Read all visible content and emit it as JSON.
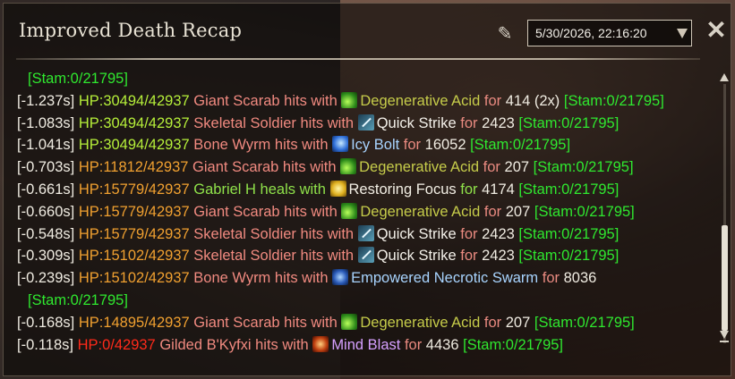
{
  "window": {
    "title": "Improved Death Recap",
    "date_value": "5/30/2026, 22:16:20"
  },
  "icons": {
    "quill": "quill-icon",
    "close": "close-icon",
    "dropdown": "chevron-down-icon"
  },
  "colors": {
    "hp_healthy": "#b6f03a",
    "hp_mid": "#f0a030",
    "hp_dead": "#ff2a1a",
    "stamina": "#2fe82f",
    "source": "#f18a80",
    "heal": "#8fe14a"
  },
  "log": {
    "wrap_top": "[Stam:0/21795]",
    "entries": [
      {
        "time": "[-1.237s]",
        "hp": "HP:30494/42937",
        "source": "Giant Scarab hits with",
        "icon": "acid-icon",
        "ability": "Degenerative Acid",
        "for": "for",
        "amount": "414",
        "extra": "(2x)",
        "stam": "[Stam:0/21795]"
      },
      {
        "time": "[-1.083s]",
        "hp": "HP:30494/42937",
        "source": "Skeletal Soldier hits with",
        "icon": "sword-icon",
        "ability": "Quick Strike",
        "for": "for",
        "amount": "2423",
        "stam": "[Stam:0/21795]"
      },
      {
        "time": "[-1.041s]",
        "hp": "HP:30494/42937",
        "source": "Bone Wyrm hits with",
        "icon": "frost-bolt-icon",
        "ability": "Icy Bolt",
        "for": "for",
        "amount": "16052",
        "stam": "[Stam:0/21795]"
      },
      {
        "time": "[-0.703s]",
        "hp": "HP:11812/42937",
        "source": "Giant Scarab hits with",
        "icon": "acid-icon",
        "ability": "Degenerative Acid",
        "for": "for",
        "amount": "207",
        "stam": "[Stam:0/21795]"
      },
      {
        "time": "[-0.661s]",
        "hp": "HP:15779/42937",
        "source": "Gabriel H heals with",
        "icon": "heal-icon",
        "ability": "Restoring Focus",
        "for": "for",
        "amount": "4174",
        "stam": "[Stam:0/21795]"
      },
      {
        "time": "[-0.660s]",
        "hp": "HP:15779/42937",
        "source": "Giant Scarab hits with",
        "icon": "acid-icon",
        "ability": "Degenerative Acid",
        "for": "for",
        "amount": "207",
        "stam": "[Stam:0/21795]"
      },
      {
        "time": "[-0.548s]",
        "hp": "HP:15779/42937",
        "source": "Skeletal Soldier hits with",
        "icon": "sword-icon",
        "ability": "Quick Strike",
        "for": "for",
        "amount": "2423",
        "stam": "[Stam:0/21795]"
      },
      {
        "time": "[-0.309s]",
        "hp": "HP:15102/42937",
        "source": "Skeletal Soldier hits with",
        "icon": "sword-icon",
        "ability": "Quick Strike",
        "for": "for",
        "amount": "2423",
        "stam": "[Stam:0/21795]"
      },
      {
        "time": "[-0.239s]",
        "hp": "HP:15102/42937",
        "source": "Bone Wyrm hits with",
        "icon": "swarm-icon",
        "ability": "Empowered Necrotic Swarm",
        "for": "for",
        "amount": "8036",
        "stam": "[Stam:0/21795]"
      },
      {
        "time": "[-0.168s]",
        "hp": "HP:14895/42937",
        "source": "Giant Scarab hits with",
        "icon": "acid-icon",
        "ability": "Degenerative Acid",
        "for": "for",
        "amount": "207",
        "stam": "[Stam:0/21795]"
      },
      {
        "time": "[-0.118s]",
        "hp": "HP:0/42937",
        "source": "Gilded B'Kyfxi hits with",
        "icon": "mind-blast-icon",
        "ability": "Mind Blast",
        "for": "for",
        "amount": "4436",
        "stam": "[Stam:0/21795]"
      }
    ]
  }
}
